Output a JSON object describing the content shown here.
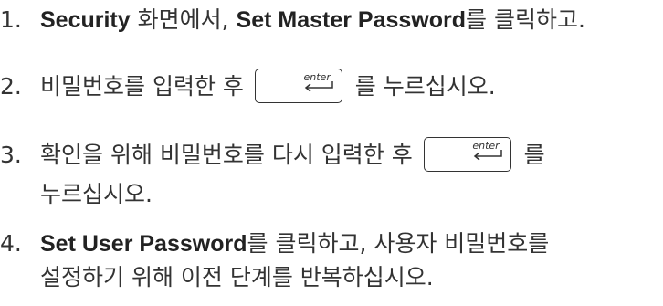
{
  "steps": [
    {
      "number": "1.",
      "term1": "Security",
      "text1": " 화면에서, ",
      "term2": "Set Master Password",
      "text2": "를 클릭하고."
    },
    {
      "number": "2.",
      "text1": "비밀번호를 입력한 후 ",
      "text2": " 를 누르십시오."
    },
    {
      "number": "3.",
      "text1": "확인을 위해 비밀번호를 다시 입력한 후 ",
      "text2": " 를",
      "text3": "누르십시오."
    },
    {
      "number": "4.",
      "term1": "Set User Password",
      "text1": "를 클릭하고, 사용자 비밀번호를",
      "text2": "설정하기 위해 이전 단계를 반복하십시오."
    }
  ],
  "enter_key": {
    "label": "enter",
    "icon": "enter-arrow-icon"
  }
}
